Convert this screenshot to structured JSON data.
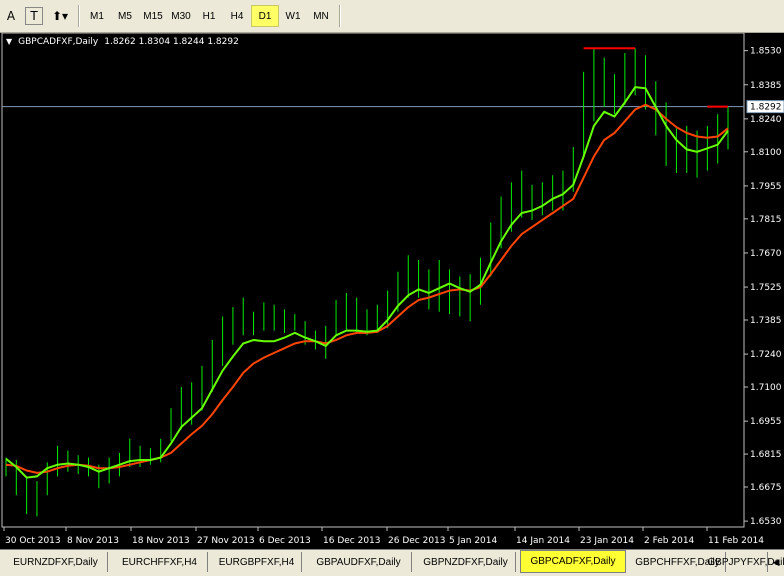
{
  "toolbar": {
    "icons": [
      "text-icon",
      "text-label-icon",
      "arrow-tools-icon"
    ],
    "timeframes": [
      {
        "label": "M1",
        "active": false
      },
      {
        "label": "M5",
        "active": false
      },
      {
        "label": "M15",
        "active": false
      },
      {
        "label": "M30",
        "active": false
      },
      {
        "label": "H1",
        "active": false
      },
      {
        "label": "H4",
        "active": false
      },
      {
        "label": "D1",
        "active": true
      },
      {
        "label": "W1",
        "active": false
      },
      {
        "label": "MN",
        "active": false
      }
    ]
  },
  "chart_header": {
    "symbol": "GBPCADFXF,Daily",
    "ohlc": "1.8262 1.8304 1.8244 1.8292"
  },
  "current_price": "1.8292",
  "chart_data": {
    "type": "line",
    "title": "",
    "price_ticks": [
      "1.8530",
      "1.8385",
      "1.8240",
      "1.8100",
      "1.7955",
      "1.7815",
      "1.7670",
      "1.7525",
      "1.7385",
      "1.7240",
      "1.7100",
      "1.6955",
      "1.6815",
      "1.6675",
      "1.6530"
    ],
    "date_ticks": [
      "30 Oct 2013",
      "8 Nov 2013",
      "18 Nov 2013",
      "27 Nov 2013",
      "6 Dec 2013",
      "16 Dec 2013",
      "26 Dec 2013",
      "5 Jan 2014",
      "14 Jan 2014",
      "23 Jan 2014",
      "2 Feb 2014",
      "11 Feb 2014"
    ],
    "ylim": [
      1.6505,
      1.8605
    ],
    "grid": false,
    "series_colors": {
      "fast": "#66ff00",
      "slow": "#ff4500",
      "bars": "#00ee00",
      "current_line": "#7f9db9",
      "peak_marker": "#ff0000"
    },
    "bars": [
      [
        1.68,
        1.672
      ],
      [
        1.679,
        1.664
      ],
      [
        1.672,
        1.656
      ],
      [
        1.67,
        1.655
      ],
      [
        1.678,
        1.664
      ],
      [
        1.685,
        1.672
      ],
      [
        1.683,
        1.674
      ],
      [
        1.681,
        1.673
      ],
      [
        1.68,
        1.672
      ],
      [
        1.677,
        1.667
      ],
      [
        1.68,
        1.669
      ],
      [
        1.682,
        1.672
      ],
      [
        1.688,
        1.676
      ],
      [
        1.685,
        1.676
      ],
      [
        1.684,
        1.677
      ],
      [
        1.688,
        1.678
      ],
      [
        1.701,
        1.687
      ],
      [
        1.71,
        1.692
      ],
      [
        1.712,
        1.694
      ],
      [
        1.719,
        1.7
      ],
      [
        1.73,
        1.708
      ],
      [
        1.74,
        1.719
      ],
      [
        1.744,
        1.728
      ],
      [
        1.748,
        1.732
      ],
      [
        1.742,
        1.732
      ],
      [
        1.746,
        1.734
      ],
      [
        1.745,
        1.734
      ],
      [
        1.743,
        1.733
      ],
      [
        1.741,
        1.734
      ],
      [
        1.738,
        1.728
      ],
      [
        1.734,
        1.726
      ],
      [
        1.736,
        1.722
      ],
      [
        1.747,
        1.732
      ],
      [
        1.75,
        1.734
      ],
      [
        1.748,
        1.733
      ],
      [
        1.743,
        1.732
      ],
      [
        1.745,
        1.733
      ],
      [
        1.751,
        1.735
      ],
      [
        1.759,
        1.742
      ],
      [
        1.766,
        1.748
      ],
      [
        1.764,
        1.748
      ],
      [
        1.76,
        1.743
      ],
      [
        1.764,
        1.742
      ],
      [
        1.76,
        1.741
      ],
      [
        1.757,
        1.74
      ],
      [
        1.758,
        1.738
      ],
      [
        1.765,
        1.745
      ],
      [
        1.78,
        1.757
      ],
      [
        1.791,
        1.769
      ],
      [
        1.797,
        1.776
      ],
      [
        1.802,
        1.782
      ],
      [
        1.796,
        1.781
      ],
      [
        1.797,
        1.783
      ],
      [
        1.8,
        1.785
      ],
      [
        1.802,
        1.785
      ],
      [
        1.812,
        1.793
      ],
      [
        1.844,
        1.808
      ],
      [
        1.854,
        1.823
      ],
      [
        1.85,
        1.829
      ],
      [
        1.843,
        1.826
      ],
      [
        1.852,
        1.83
      ],
      [
        1.854,
        1.834
      ],
      [
        1.851,
        1.828
      ],
      [
        1.84,
        1.817
      ],
      [
        1.831,
        1.804
      ],
      [
        1.82,
        1.801
      ],
      [
        1.821,
        1.801
      ],
      [
        1.819,
        1.799
      ],
      [
        1.821,
        1.802
      ],
      [
        1.826,
        1.805
      ],
      [
        1.829,
        1.811
      ]
    ],
    "series": [
      {
        "values": [
          1.6795,
          1.676,
          1.6715,
          1.672,
          1.6755,
          1.677,
          1.6775,
          1.677,
          1.676,
          1.674,
          1.6755,
          1.677,
          1.6785,
          1.679,
          1.679,
          1.68,
          1.686,
          1.693,
          1.697,
          1.701,
          1.709,
          1.717,
          1.723,
          1.7285,
          1.73,
          1.7295,
          1.7295,
          1.731,
          1.733,
          1.731,
          1.7295,
          1.7275,
          1.732,
          1.734,
          1.734,
          1.7335,
          1.734,
          1.7385,
          1.7445,
          1.749,
          1.7515,
          1.75,
          1.752,
          1.754,
          1.752,
          1.7505,
          1.7535,
          1.763,
          1.772,
          1.779,
          1.784,
          1.785,
          1.787,
          1.79,
          1.792,
          1.796,
          1.808,
          1.821,
          1.827,
          1.825,
          1.831,
          1.8375,
          1.837,
          1.829,
          1.821,
          1.815,
          1.811,
          1.81,
          1.8115,
          1.813,
          1.819
        ]
      },
      {
        "values": [
          1.677,
          1.6765,
          1.6745,
          1.6735,
          1.674,
          1.6755,
          1.6765,
          1.677,
          1.6765,
          1.6755,
          1.6755,
          1.676,
          1.677,
          1.678,
          1.679,
          1.68,
          1.682,
          1.686,
          1.69,
          1.6935,
          1.6985,
          1.7045,
          1.71,
          1.716,
          1.72,
          1.7225,
          1.7245,
          1.7265,
          1.7285,
          1.7295,
          1.7295,
          1.7285,
          1.73,
          1.732,
          1.733,
          1.733,
          1.7335,
          1.736,
          1.74,
          1.744,
          1.747,
          1.748,
          1.7495,
          1.751,
          1.7515,
          1.751,
          1.7525,
          1.758,
          1.764,
          1.77,
          1.775,
          1.778,
          1.781,
          1.784,
          1.787,
          1.79,
          1.799,
          1.808,
          1.815,
          1.818,
          1.823,
          1.828,
          1.83,
          1.828,
          1.824,
          1.8205,
          1.818,
          1.8165,
          1.816,
          1.8165,
          1.82
        ]
      }
    ],
    "current_value": 1.8292,
    "peak_marker": {
      "value": 1.854,
      "start_bar": 56,
      "end_bar": 61
    },
    "last_marker": {
      "value": 1.8292,
      "start_bar": 68,
      "end_bar": 70
    }
  },
  "tabs": [
    {
      "label": "EURNZDFXF,Daily",
      "active": false
    },
    {
      "label": "EURCHFFXF,H4",
      "active": false
    },
    {
      "label": "EURGBPFXF,H4",
      "active": false
    },
    {
      "label": "GBPAUDFXF,Daily",
      "active": false
    },
    {
      "label": "GBPNZDFXF,Daily",
      "active": false
    },
    {
      "label": "GBPCADFXF,Daily",
      "active": true
    },
    {
      "label": "GBPCHFFXF,Daily",
      "active": false
    },
    {
      "label": "GBPJPYFXF,Daily",
      "active": false
    }
  ]
}
